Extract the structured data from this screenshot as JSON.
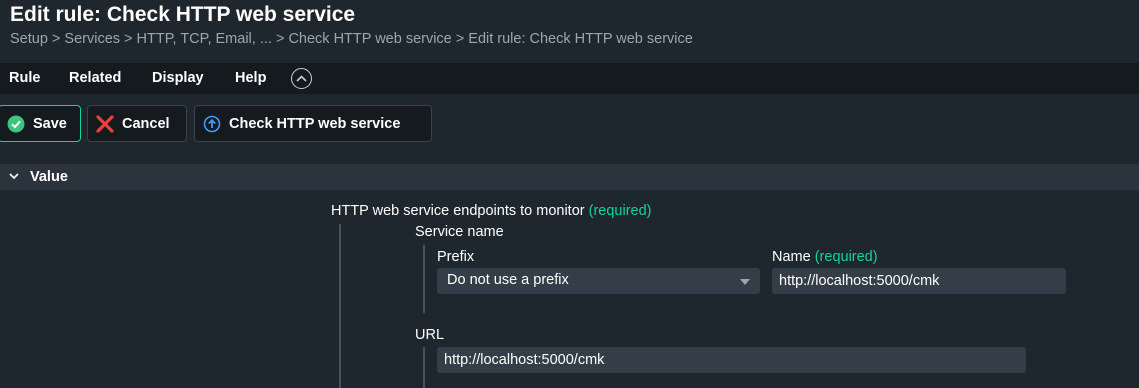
{
  "page": {
    "title": "Edit rule: Check HTTP web service",
    "breadcrumb": "Setup > Services > HTTP, TCP, Email, ... > Check HTTP web service > Edit rule: Check HTTP web service"
  },
  "menu": {
    "items": [
      "Rule",
      "Related",
      "Display",
      "Help"
    ],
    "toggle_icon": "chevron-up-circle-icon"
  },
  "toolbar": {
    "save_label": "Save",
    "cancel_label": "Cancel",
    "service_label": "Check HTTP web service"
  },
  "section": {
    "label": "Value"
  },
  "form": {
    "endpoints_label": "HTTP web service endpoints to monitor",
    "required_text": "(required)",
    "service_name_label": "Service name",
    "prefix_label": "Prefix",
    "prefix_value": "Do not use a prefix",
    "name_label": "Name",
    "name_value": "http://localhost:5000/cmk",
    "url_label": "URL",
    "url_value": "http://localhost:5000/cmk"
  },
  "colors": {
    "background": "#1e262e",
    "menubar": "#151a1f",
    "section_header": "#2b343d",
    "accent_green": "#15d1a0",
    "cancel_red": "#e8423a",
    "info_blue": "#3f9bff",
    "input_bg": "#343e48"
  }
}
